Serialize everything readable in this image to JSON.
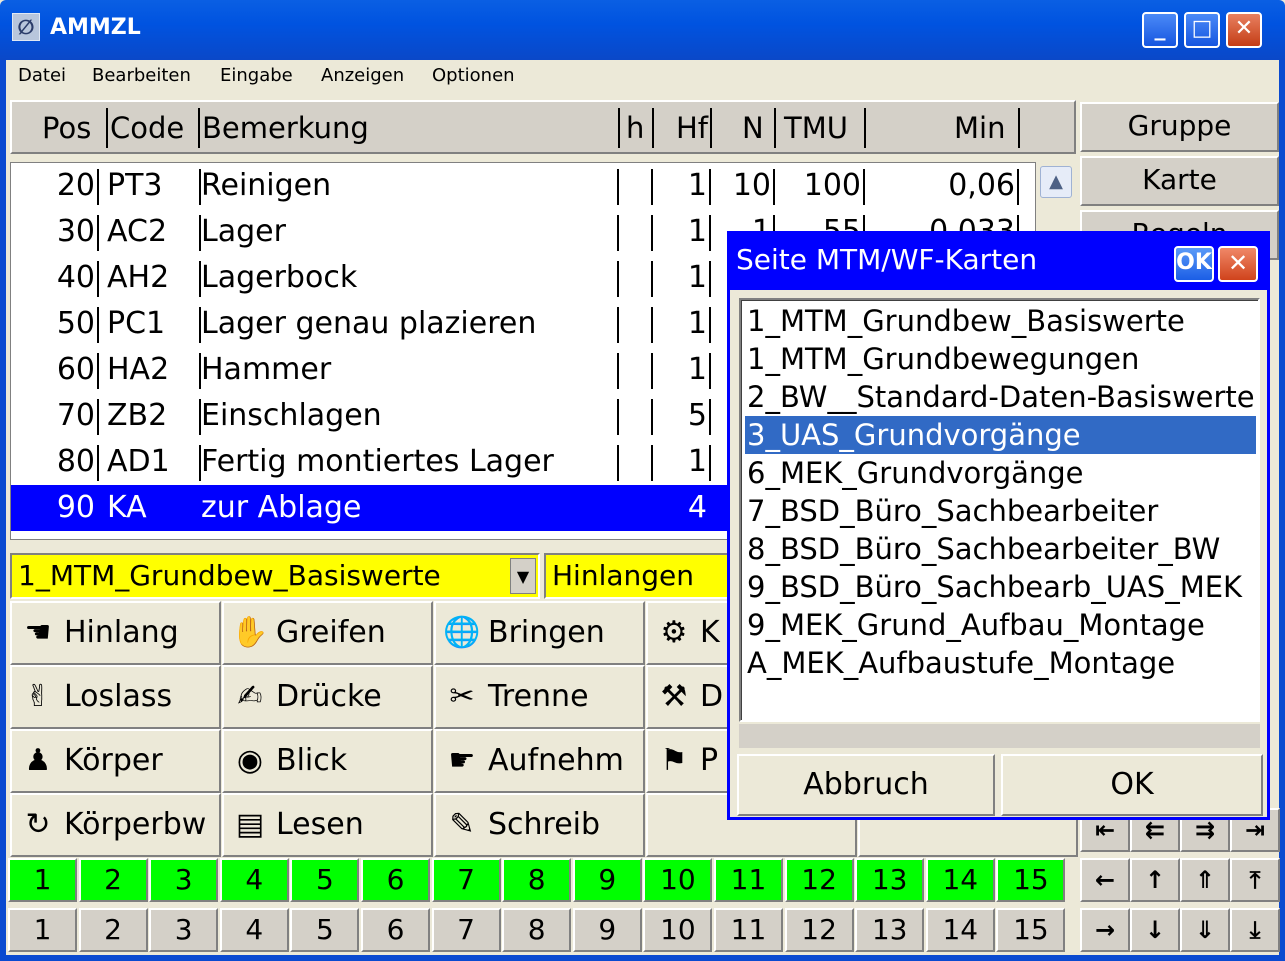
{
  "window": {
    "title": "AMMZL",
    "icon": "ammzl-app-icon",
    "minimize": "_",
    "maximize": "□",
    "close": "✕"
  },
  "menu": [
    "Datei",
    "Bearbeiten",
    "Eingabe",
    "Anzeigen",
    "Optionen"
  ],
  "grid": {
    "headers": {
      "pos": "Pos",
      "code": "Code",
      "bem": "Bemerkung",
      "h": "h",
      "hf": "Hf",
      "n": "N",
      "tmu": "TMU",
      "min": "Min"
    },
    "rows": [
      {
        "pos": "20",
        "code": "PT3",
        "bem": "Reinigen",
        "h": "",
        "hf": "1",
        "n": "10",
        "tmu": "100",
        "min": "0,06"
      },
      {
        "pos": "30",
        "code": "AC2",
        "bem": "Lager",
        "h": "",
        "hf": "1",
        "n": "1",
        "tmu": "55",
        "min": "0,033"
      },
      {
        "pos": "40",
        "code": "AH2",
        "bem": "Lagerbock",
        "h": "",
        "hf": "1",
        "n": "",
        "tmu": "",
        "min": ""
      },
      {
        "pos": "50",
        "code": "PC1",
        "bem": "Lager genau plazieren",
        "h": "",
        "hf": "1",
        "n": "",
        "tmu": "",
        "min": ""
      },
      {
        "pos": "60",
        "code": "HA2",
        "bem": "Hammer",
        "h": "",
        "hf": "1",
        "n": "",
        "tmu": "",
        "min": ""
      },
      {
        "pos": "70",
        "code": "ZB2",
        "bem": "Einschlagen",
        "h": "",
        "hf": "5",
        "n": "",
        "tmu": "",
        "min": ""
      },
      {
        "pos": "80",
        "code": "AD1",
        "bem": "Fertig montiertes Lager",
        "h": "",
        "hf": "1",
        "n": "",
        "tmu": "",
        "min": ""
      },
      {
        "pos": "90",
        "code": "KA",
        "bem": "zur Ablage",
        "h": "",
        "hf": "4",
        "n": "",
        "tmu": "",
        "min": ""
      }
    ],
    "selected_row": 7
  },
  "right_buttons": [
    "Gruppe",
    "Karte",
    "Regeln"
  ],
  "category_combo": {
    "value": "1_MTM_Grundbew_Basiswerte"
  },
  "motion_field": {
    "value": "Hinlangen"
  },
  "motion_buttons": [
    {
      "label": "Hinlang",
      "icon": "reaching-hand-icon"
    },
    {
      "label": "Greifen",
      "icon": "grasping-hand-icon"
    },
    {
      "label": "Bringen",
      "icon": "globe-icon"
    },
    {
      "label": "K",
      "icon": "robot-icon"
    },
    {
      "label": "Loslass",
      "icon": "release-hand-icon"
    },
    {
      "label": "Drücke",
      "icon": "pressing-hand-icon"
    },
    {
      "label": "Trenne",
      "icon": "scissors-icon"
    },
    {
      "label": "D",
      "icon": "tool-icon"
    },
    {
      "label": "Körper",
      "icon": "person-icon"
    },
    {
      "label": "Blick",
      "icon": "eye-icon"
    },
    {
      "label": "Aufnehm",
      "icon": "pick-up-icon"
    },
    {
      "label": "P",
      "icon": "position-icon"
    },
    {
      "label": "Körperbw",
      "icon": "body-motion-icon"
    },
    {
      "label": "Lesen",
      "icon": "document-icon"
    },
    {
      "label": "Schreib",
      "icon": "pen-icon"
    }
  ],
  "number_row_green": [
    "1",
    "2",
    "3",
    "4",
    "5",
    "6",
    "7",
    "8",
    "9",
    "10",
    "11",
    "12",
    "13",
    "14",
    "15"
  ],
  "number_row_gray": [
    "1",
    "2",
    "3",
    "4",
    "5",
    "6",
    "7",
    "8",
    "9",
    "10",
    "11",
    "12",
    "13",
    "14",
    "15"
  ],
  "nav_buttons": {
    "row1": [
      "⇤",
      "⇇",
      "⇉",
      "⇥"
    ],
    "row2": [
      "←",
      "↑",
      "⇑",
      "⤒"
    ],
    "row3": [
      "→",
      "↓",
      "⇓",
      "⤓"
    ]
  },
  "dialog": {
    "title": "Seite  MTM/WF-Karten",
    "ok_small": "OK",
    "close": "✕",
    "items": [
      "1_MTM_Grundbew_Basiswerte",
      "1_MTM_Grundbewegungen",
      "2_BW__Standard-Daten-Basiswerte",
      "3_UAS_Grundvorgänge",
      "6_MEK_Grundvorgänge",
      "7_BSD_Büro_Sachbearbeiter",
      "8_BSD_Büro_Sachbearbeiter_BW",
      "9_BSD_Büro_Sachbearb_UAS_MEK",
      "9_MEK_Grund_Aufbau_Montage",
      "A_MEK_Aufbaustufe_Montage"
    ],
    "selected_index": 3,
    "cancel": "Abbruch",
    "ok": "OK"
  },
  "colors": {
    "selection": "#0000ff",
    "list_selection": "#316ac5",
    "yellow": "#ffff00",
    "green": "#00ff00",
    "titlebar": "#0053e0"
  }
}
